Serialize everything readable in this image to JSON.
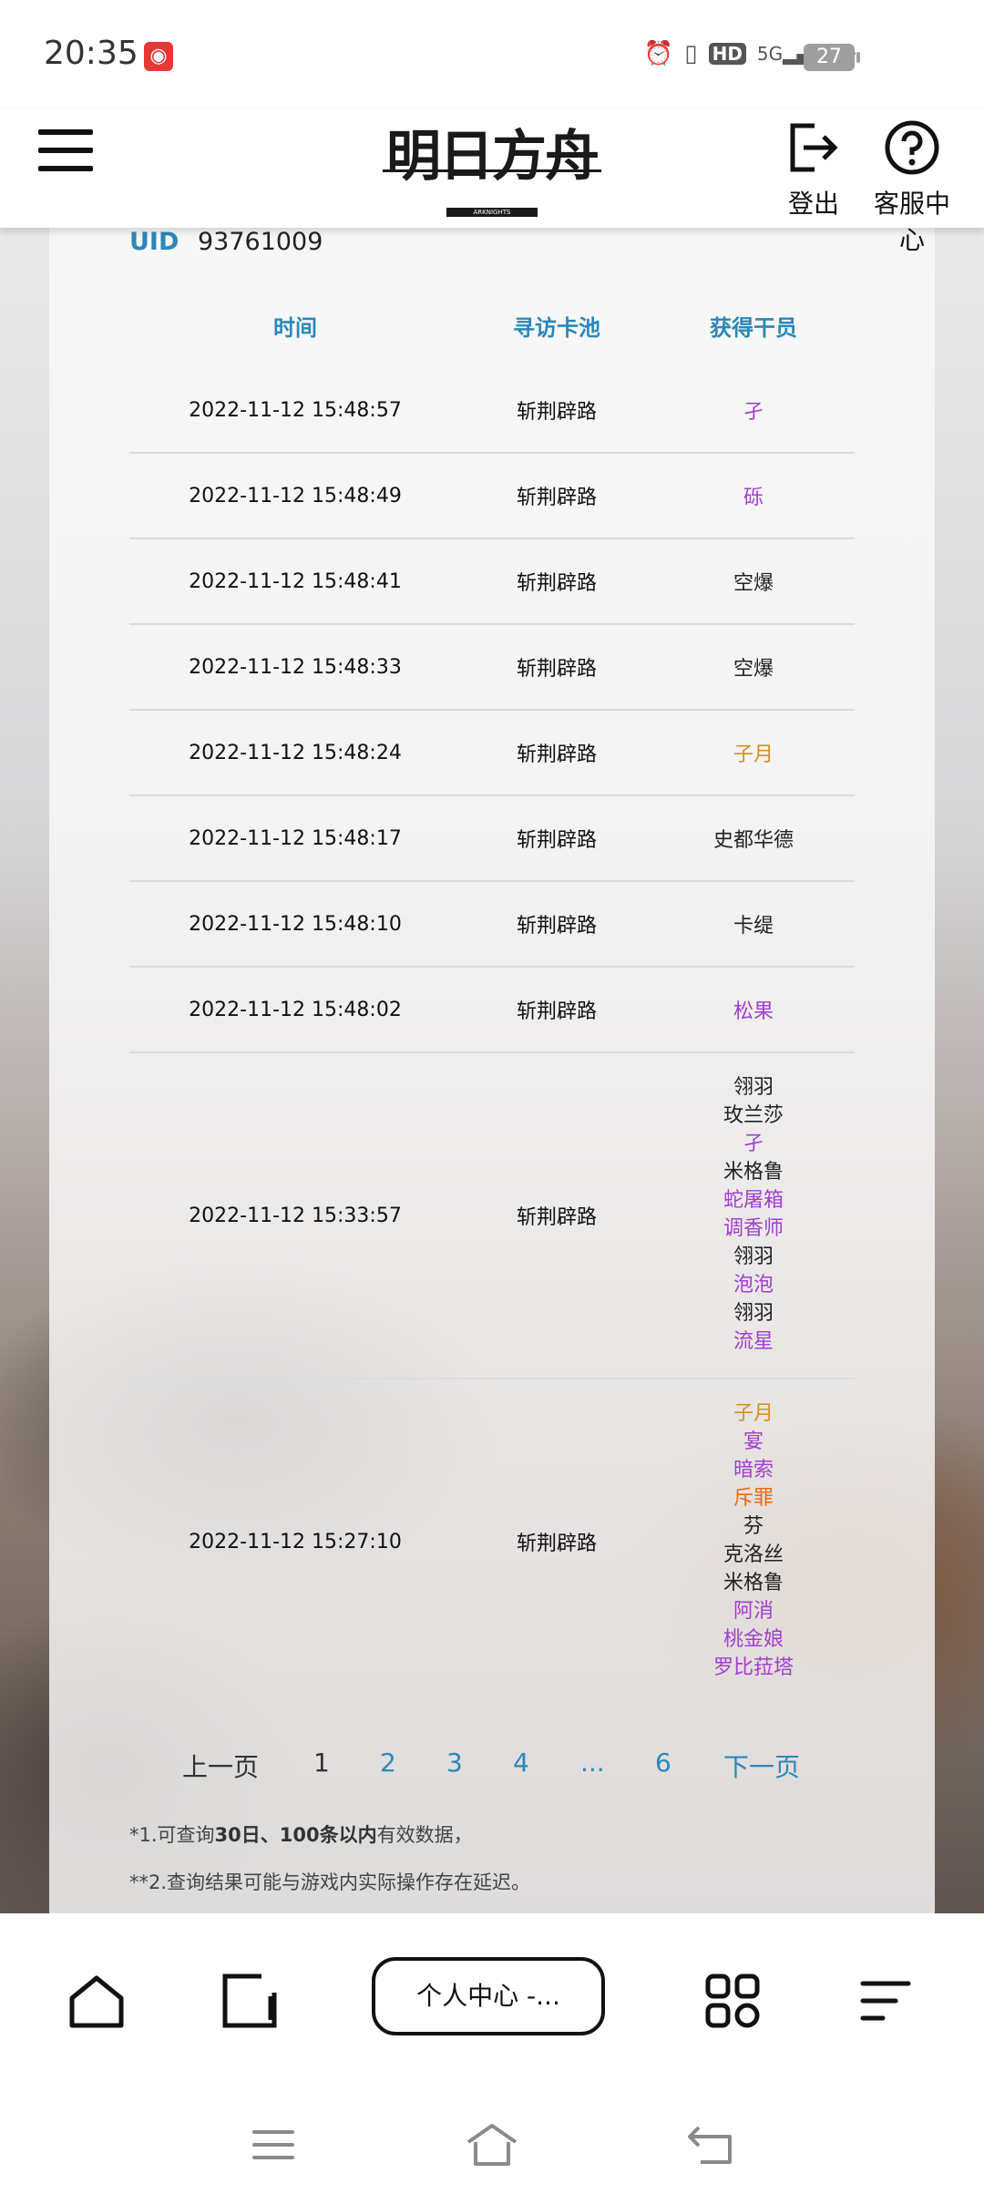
{
  "status_bar": {
    "time": "20:35",
    "network": "5G",
    "hd": "HD",
    "battery": "27"
  },
  "header": {
    "logo_text": "明日方舟",
    "logo_sub": "ARKNIGHTS",
    "logout_label": "登出",
    "help_label": "客服中心"
  },
  "account": {
    "uid_label": "UID",
    "uid_value": "93761009"
  },
  "table": {
    "headers": [
      "时间",
      "寻访卡池",
      "获得干员"
    ],
    "rows": [
      {
        "time": "2022-11-12 15:48:57",
        "pool": "斩荆辟路",
        "ops": [
          {
            "name": "孑",
            "rarity": 4
          }
        ]
      },
      {
        "time": "2022-11-12 15:48:49",
        "pool": "斩荆辟路",
        "ops": [
          {
            "name": "砾",
            "rarity": 4
          }
        ]
      },
      {
        "time": "2022-11-12 15:48:41",
        "pool": "斩荆辟路",
        "ops": [
          {
            "name": "空爆",
            "rarity": 3
          }
        ]
      },
      {
        "time": "2022-11-12 15:48:33",
        "pool": "斩荆辟路",
        "ops": [
          {
            "name": "空爆",
            "rarity": 3
          }
        ]
      },
      {
        "time": "2022-11-12 15:48:24",
        "pool": "斩荆辟路",
        "ops": [
          {
            "name": "子月",
            "rarity": 5
          }
        ]
      },
      {
        "time": "2022-11-12 15:48:17",
        "pool": "斩荆辟路",
        "ops": [
          {
            "name": "史都华德",
            "rarity": 3
          }
        ]
      },
      {
        "time": "2022-11-12 15:48:10",
        "pool": "斩荆辟路",
        "ops": [
          {
            "name": "卡缇",
            "rarity": 3
          }
        ]
      },
      {
        "time": "2022-11-12 15:48:02",
        "pool": "斩荆辟路",
        "ops": [
          {
            "name": "松果",
            "rarity": 4
          }
        ]
      },
      {
        "time": "2022-11-12 15:33:57",
        "pool": "斩荆辟路",
        "ops": [
          {
            "name": "翎羽",
            "rarity": 3
          },
          {
            "name": "玫兰莎",
            "rarity": 3
          },
          {
            "name": "孑",
            "rarity": 4
          },
          {
            "name": "米格鲁",
            "rarity": 3
          },
          {
            "name": "蛇屠箱",
            "rarity": 4
          },
          {
            "name": "调香师",
            "rarity": 4
          },
          {
            "name": "翎羽",
            "rarity": 3
          },
          {
            "name": "泡泡",
            "rarity": 4
          },
          {
            "name": "翎羽",
            "rarity": 3
          },
          {
            "name": "流星",
            "rarity": 4
          }
        ]
      },
      {
        "time": "2022-11-12 15:27:10",
        "pool": "斩荆辟路",
        "ops": [
          {
            "name": "子月",
            "rarity": 5
          },
          {
            "name": "宴",
            "rarity": 4
          },
          {
            "name": "暗索",
            "rarity": 4
          },
          {
            "name": "斥罪",
            "rarity": 6
          },
          {
            "name": "芬",
            "rarity": 3
          },
          {
            "name": "克洛丝",
            "rarity": 3
          },
          {
            "name": "米格鲁",
            "rarity": 3
          },
          {
            "name": "阿消",
            "rarity": 4
          },
          {
            "name": "桃金娘",
            "rarity": 4
          },
          {
            "name": "罗比菈塔",
            "rarity": 4
          }
        ]
      }
    ]
  },
  "pagination": {
    "prev": "上一页",
    "pages": [
      "1",
      "2",
      "3",
      "4",
      "...",
      "6"
    ],
    "current": "1",
    "next": "下一页"
  },
  "notes": {
    "note1_prefix": "*1.可查询",
    "note1_bold": "30日、100条以内",
    "note1_suffix": "有效数据，",
    "note2": "**2.查询结果可能与游戏内实际操作存在延迟。"
  },
  "browser_bar": {
    "tab_label": "个人中心 -..."
  },
  "colors": {
    "accent": "#2b88b8",
    "rarity3": "#222222",
    "rarity4": "#a23fcf",
    "rarity5": "#d4901b",
    "rarity6": "#e66d17"
  }
}
